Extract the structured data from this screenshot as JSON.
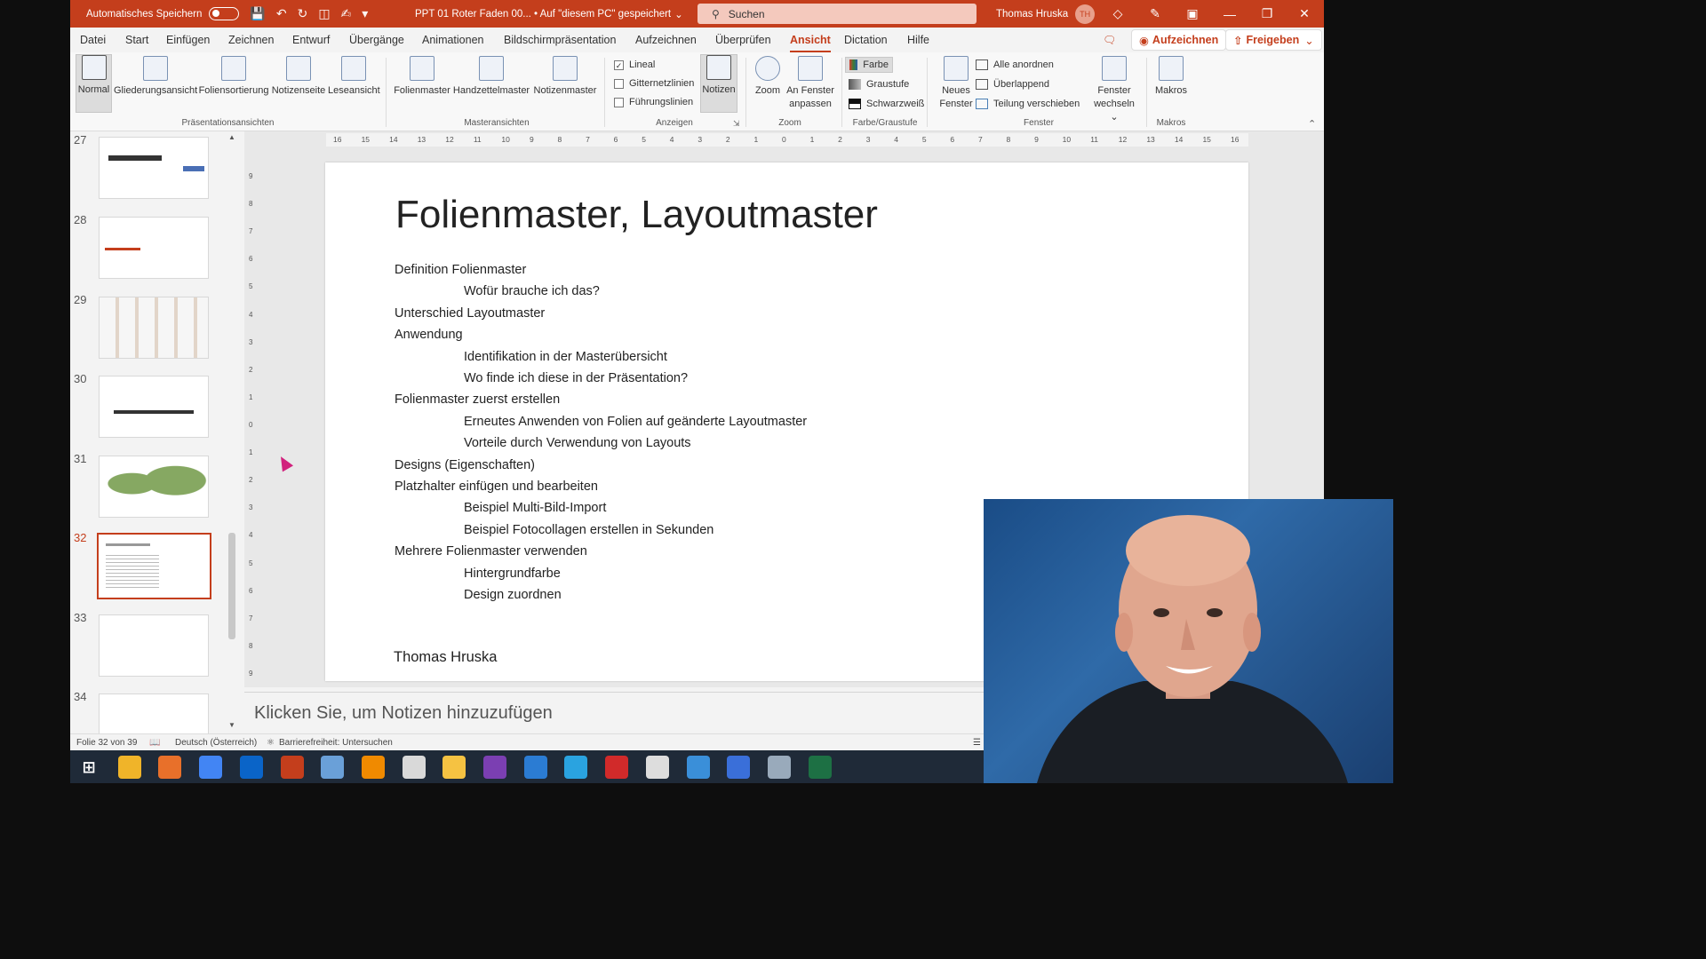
{
  "titlebar": {
    "autosave_label": "Automatisches Speichern",
    "file_title": "PPT 01 Roter Faden 00... • Auf \"diesem PC\" gespeichert",
    "search_placeholder": "Suchen",
    "user_name": "Thomas Hruska",
    "user_initials": "TH"
  },
  "tabs": [
    "Datei",
    "Start",
    "Einfügen",
    "Zeichnen",
    "Entwurf",
    "Übergänge",
    "Animationen",
    "Bildschirmpräsentation",
    "Aufzeichnen",
    "Überprüfen",
    "Ansicht",
    "Dictation",
    "Hilfe"
  ],
  "active_tab": "Ansicht",
  "tab_buttons": {
    "record": "Aufzeichnen",
    "share": "Freigeben"
  },
  "ribbon": {
    "presentation_views": [
      "Normal",
      "Gliederungsansicht",
      "Foliensortierung",
      "Notizenseite",
      "Leseansicht"
    ],
    "presentation_views_group": "Präsentationsansichten",
    "master_views": [
      "Folienmaster",
      "Handzettelmaster",
      "Notizenmaster"
    ],
    "master_views_group": "Masteransichten",
    "show": {
      "ruler": "Lineal",
      "gridlines": "Gitternetzlinien",
      "guides": "Führungslinien",
      "notes": "Notizen",
      "ruler_checked": true
    },
    "show_group": "Anzeigen",
    "zoom": {
      "zoom": "Zoom",
      "fit_line1": "An Fenster",
      "fit_line2": "anpassen"
    },
    "zoom_group": "Zoom",
    "color": {
      "color": "Farbe",
      "grayscale": "Graustufe",
      "bw": "Schwarzweiß"
    },
    "color_group": "Farbe/Graustufe",
    "window": {
      "new_line1": "Neues",
      "new_line2": "Fenster",
      "arrange_all": "Alle anordnen",
      "cascade": "Überlappend",
      "move_split": "Teilung verschieben",
      "switch_line1": "Fenster",
      "switch_line2": "wechseln"
    },
    "window_group": "Fenster",
    "macros": {
      "label": "Makros"
    },
    "macros_group": "Makros"
  },
  "thumbnails": [
    {
      "num": "27"
    },
    {
      "num": "28"
    },
    {
      "num": "29"
    },
    {
      "num": "30"
    },
    {
      "num": "31"
    },
    {
      "num": "32"
    },
    {
      "num": "33"
    },
    {
      "num": "34"
    }
  ],
  "current_slide": "32",
  "ruler_h": [
    "16",
    "15",
    "14",
    "13",
    "12",
    "11",
    "10",
    "9",
    "8",
    "7",
    "6",
    "5",
    "4",
    "3",
    "2",
    "1",
    "0",
    "1",
    "2",
    "3",
    "4",
    "5",
    "6",
    "7",
    "8",
    "9",
    "10",
    "11",
    "12",
    "13",
    "14",
    "15",
    "16"
  ],
  "ruler_v": [
    "9",
    "8",
    "7",
    "6",
    "5",
    "4",
    "3",
    "2",
    "1",
    "0",
    "1",
    "2",
    "3",
    "4",
    "5",
    "6",
    "7",
    "8",
    "9"
  ],
  "slide": {
    "title": "Folienmaster, Layoutmaster",
    "lines": [
      {
        "text": "Definition Folienmaster",
        "level": 1
      },
      {
        "text": "Wofür brauche ich das?",
        "level": 2
      },
      {
        "text": "Unterschied Layoutmaster",
        "level": 1
      },
      {
        "text": "Anwendung",
        "level": 1
      },
      {
        "text": "Identifikation in der Masterübersicht",
        "level": 2
      },
      {
        "text": "Wo finde ich diese in der Präsentation?",
        "level": 2
      },
      {
        "text": "Folienmaster zuerst erstellen",
        "level": 1
      },
      {
        "text": "Erneutes Anwenden von Folien auf geänderte Layoutmaster",
        "level": 2
      },
      {
        "text": "Vorteile durch Verwendung von Layouts",
        "level": 2
      },
      {
        "text": "Designs (Eigenschaften)",
        "level": 1
      },
      {
        "text": "Platzhalter einfügen und bearbeiten",
        "level": 1
      },
      {
        "text": "Beispiel Multi-Bild-Import",
        "level": 2
      },
      {
        "text": "Beispiel Fotocollagen erstellen in Sekunden",
        "level": 2
      },
      {
        "text": "Mehrere Folienmaster verwenden",
        "level": 1
      },
      {
        "text": "Hintergrundfarbe",
        "level": 2
      },
      {
        "text": "Design zuordnen",
        "level": 2
      }
    ],
    "author": "Thomas Hruska"
  },
  "notes_placeholder": "Klicken Sie, um Notizen hinzuzufügen",
  "status": {
    "slide_counter": "Folie 32 von 39",
    "language": "Deutsch (Österreich)",
    "accessibility": "Barrierefreiheit: Untersuchen"
  },
  "colors": {
    "accent": "#c43e1c",
    "taskbar": "#1f2a38"
  },
  "taskbar_icons": [
    "windows-start-icon",
    "file-explorer-icon",
    "firefox-icon",
    "chrome-icon",
    "outlook-icon",
    "powerpoint-icon",
    "app-icon",
    "vlc-icon",
    "app-icon",
    "app-icon",
    "onenote-icon",
    "visio-icon",
    "telegram-icon",
    "acrobat-icon",
    "app-icon",
    "app-icon",
    "app-icon",
    "app-icon",
    "excel-icon"
  ]
}
